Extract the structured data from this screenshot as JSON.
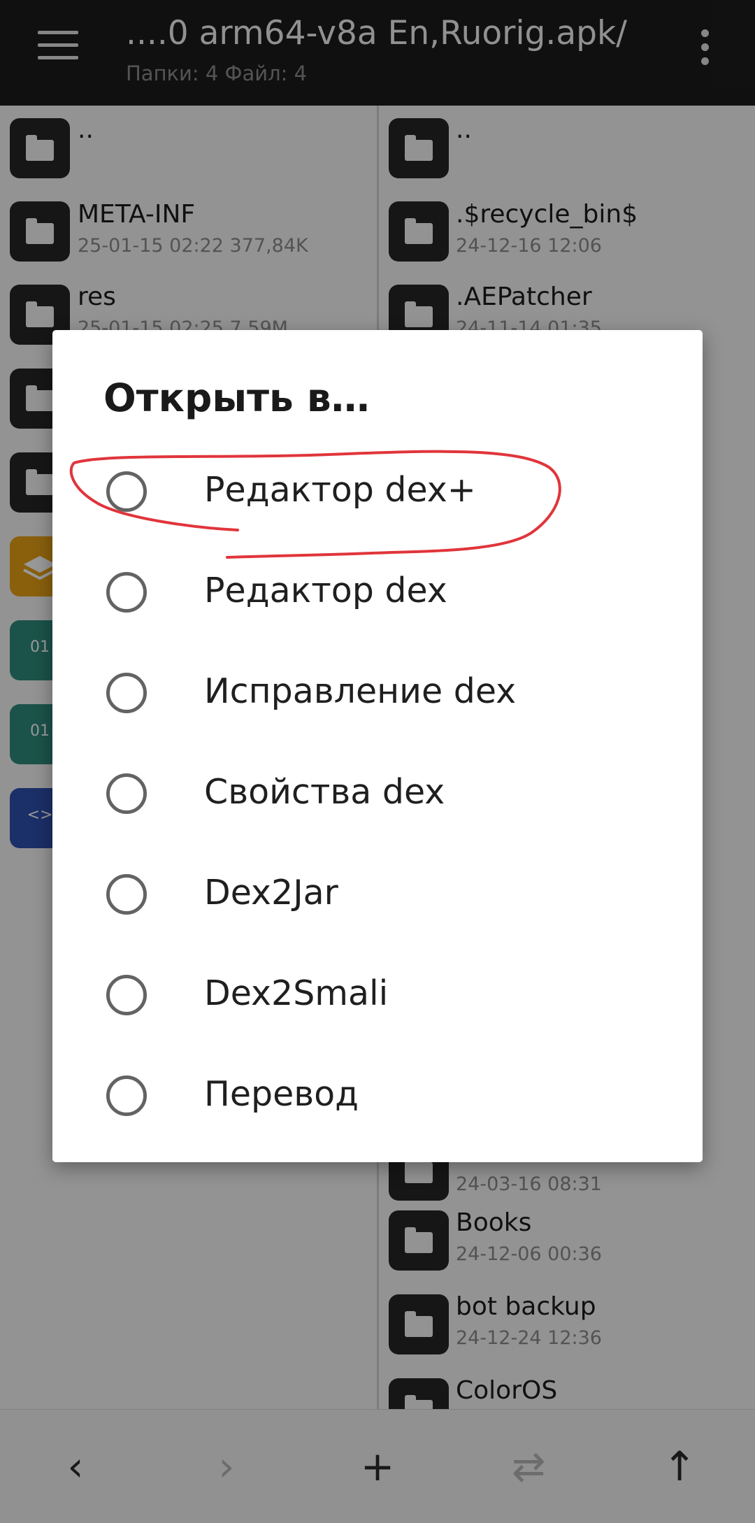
{
  "header": {
    "title": "....0 arm64-v8a En,Ruorig.apk/",
    "subtitle": "Папки: 4  Файл: 4",
    "menu_icon": "hamburger-menu-icon",
    "overflow_icon": "more-vertical-icon"
  },
  "left_pane": {
    "items": [
      {
        "name": "..",
        "meta": "",
        "icon": "folder-icon"
      },
      {
        "name": "META-INF",
        "meta": "25-01-15 02:22  377,84K",
        "icon": "folder-icon"
      },
      {
        "name": "res",
        "meta": "25-01-15 02:25  7,59M",
        "icon": "folder-icon"
      },
      {
        "name": "",
        "meta": "",
        "icon": "folder-icon"
      },
      {
        "name": "",
        "meta": "",
        "icon": "folder-icon"
      },
      {
        "name": "",
        "meta": "",
        "icon": "layers-icon"
      },
      {
        "name": "",
        "meta": "",
        "icon": "binary-file-icon",
        "glyph": "01"
      },
      {
        "name": "",
        "meta": "",
        "icon": "binary-file-icon",
        "glyph": "01"
      },
      {
        "name": "",
        "meta": "",
        "icon": "code-file-icon",
        "glyph": "<>"
      }
    ]
  },
  "right_pane": {
    "items": [
      {
        "name": "..",
        "meta": "",
        "icon": "folder-icon"
      },
      {
        "name": ".$recycle_bin$",
        "meta": "24-12-16 12:06",
        "icon": "folder-icon"
      },
      {
        "name": ".AEPatcher",
        "meta": "24-11-14 01:35",
        "icon": "folder-icon"
      },
      {
        "name": "",
        "meta": "24-03-16 08:31",
        "icon": "folder-icon"
      },
      {
        "name": "Books",
        "meta": "24-12-06 00:36",
        "icon": "folder-icon"
      },
      {
        "name": "bot backup",
        "meta": "24-12-24 12:36",
        "icon": "folder-icon"
      },
      {
        "name": "ColorOS",
        "meta": "",
        "icon": "folder-icon"
      }
    ]
  },
  "bottom_bar": {
    "back": "‹",
    "forward": "›",
    "add": "+",
    "swap": "⇄",
    "up": "↑"
  },
  "dialog": {
    "title": "Открыть в…",
    "options": [
      {
        "label": "Редактор dex+",
        "selected": false,
        "highlighted": true
      },
      {
        "label": "Редактор dex",
        "selected": false
      },
      {
        "label": "Исправление dex",
        "selected": false
      },
      {
        "label": "Свойства dex",
        "selected": false
      },
      {
        "label": "Dex2Jar",
        "selected": false
      },
      {
        "label": "Dex2Smali",
        "selected": false
      },
      {
        "label": "Перевод",
        "selected": false
      }
    ]
  },
  "colors": {
    "topbar": "#1c1c1c",
    "annotation_stroke": "#e0353b",
    "radio_border": "#636363"
  }
}
